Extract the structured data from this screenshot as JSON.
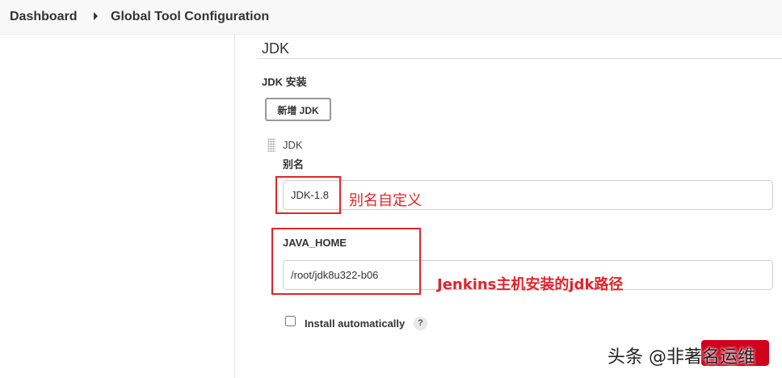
{
  "breadcrumb": {
    "items": [
      "Dashboard",
      "Global Tool Configuration"
    ]
  },
  "section": {
    "title": "JDK",
    "install_label": "JDK 安装",
    "add_button": "新增 JDK"
  },
  "jdk_entry": {
    "header": "JDK",
    "alias_label": "别名",
    "alias_value": "JDK-1.8",
    "java_home_label": "JAVA_HOME",
    "java_home_value": "/root/jdk8u322-b06",
    "install_auto_label": "Install automatically",
    "install_auto_checked": false,
    "help_glyph": "?"
  },
  "annotations": {
    "alias_note": "别名自定义",
    "home_note": "Jenkins主机安装的jdk路径",
    "color": "#e0242b"
  },
  "footer": {
    "watermark": "头条 @非著名运维",
    "save_color": "#d0021b"
  },
  "icons": {
    "breadcrumb_separator": "chevron-right-icon",
    "drag_handle": "drag-handle-icon",
    "help": "help-icon"
  }
}
